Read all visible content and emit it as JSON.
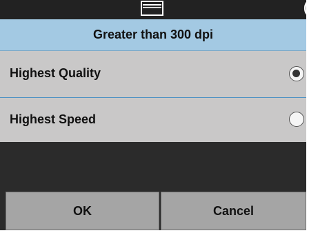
{
  "status_bar": {
    "icon": "scanner-icon",
    "edge_glyph": "(",
    "background_color": "#222222"
  },
  "dialog": {
    "title": "Greater than 300 dpi",
    "title_bar_color": "#a3c9e3"
  },
  "options": [
    {
      "label": "Highest Quality",
      "selected": true
    },
    {
      "label": "Highest Speed",
      "selected": false
    }
  ],
  "buttons": {
    "ok_label": "OK",
    "cancel_label": "Cancel",
    "button_color": "#a5a5a5"
  },
  "colors": {
    "row_background": "#c9c8c8",
    "divider": "#4f92c4",
    "dark_background": "#2b2b2b"
  }
}
